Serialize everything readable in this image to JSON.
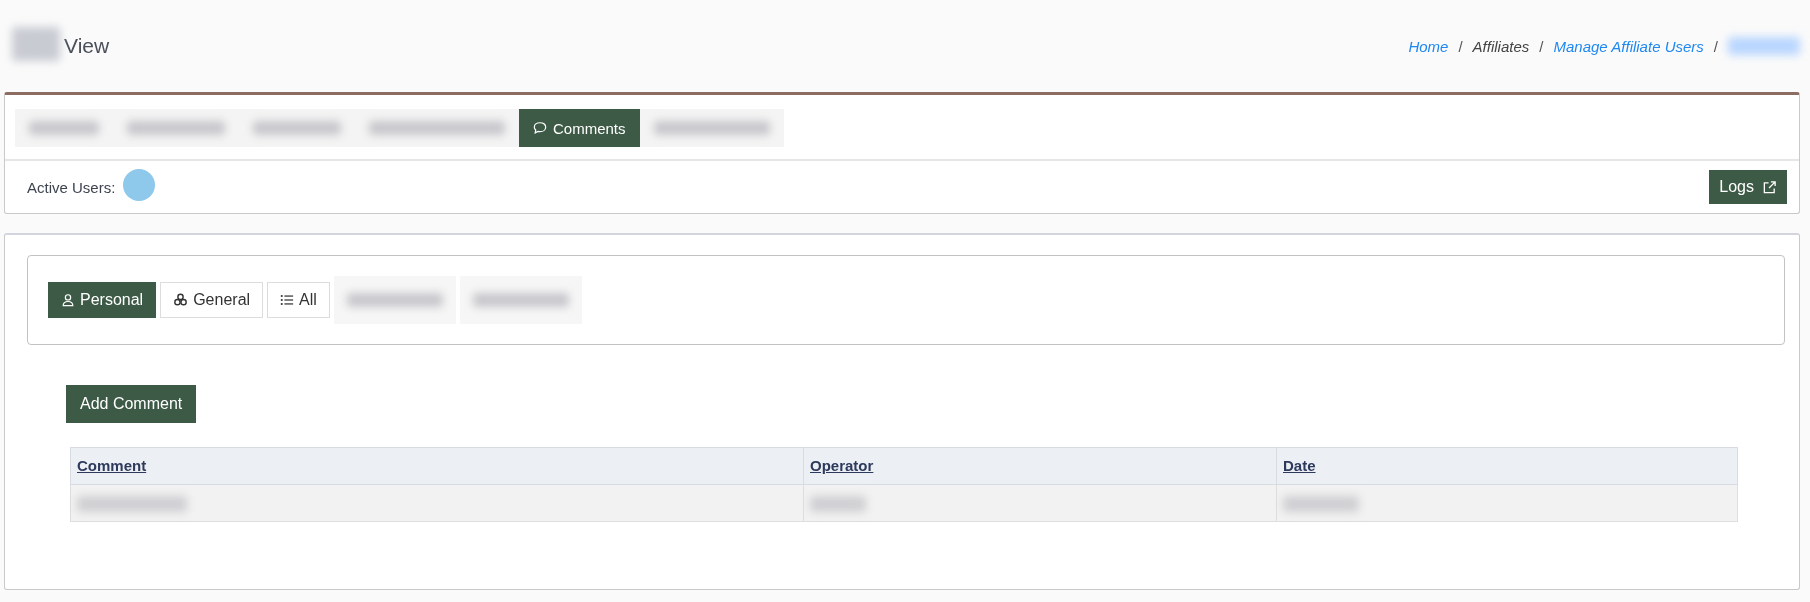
{
  "header": {
    "logo": {
      "kind": "blurred"
    },
    "title": "View"
  },
  "breadcrumb": [
    {
      "label": "Home",
      "kind": "link"
    },
    {
      "label": "/",
      "kind": "separator"
    },
    {
      "label": "Affiliates",
      "kind": "text"
    },
    {
      "label": "/",
      "kind": "separator"
    },
    {
      "label": "Manage Affiliate Users",
      "kind": "link"
    },
    {
      "label": "/",
      "kind": "separator"
    },
    {
      "kind": "blurred"
    }
  ],
  "tabs": [
    {
      "kind": "blurred",
      "selected": false
    },
    {
      "kind": "blurred",
      "selected": false
    },
    {
      "kind": "blurred",
      "selected": false
    },
    {
      "kind": "blurred",
      "selected": false
    },
    {
      "kind": "label",
      "label": "Comments",
      "selected": true
    },
    {
      "kind": "blurred",
      "selected": false
    }
  ],
  "active_users": {
    "label": "Active Users:",
    "avatars": [
      {
        "kind": "blurred"
      }
    ]
  },
  "logs_button": {
    "label": "Logs"
  },
  "filters": [
    {
      "kind": "label",
      "label": "Personal",
      "selected": true
    },
    {
      "kind": "label",
      "label": "General",
      "selected": false
    },
    {
      "kind": "label",
      "label": "All",
      "selected": false
    },
    {
      "kind": "blurred",
      "selected": false
    },
    {
      "kind": "blurred",
      "selected": false
    }
  ],
  "add_comment_button": {
    "label": "Add Comment"
  },
  "table": {
    "columns": [
      "Comment",
      "Operator",
      "Date"
    ],
    "rows": [
      {
        "kind": "blurred"
      }
    ]
  }
}
